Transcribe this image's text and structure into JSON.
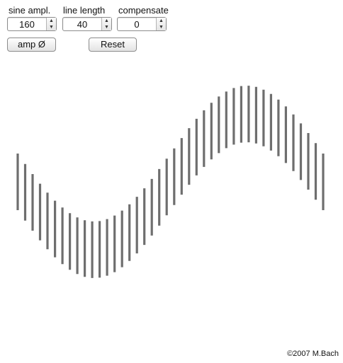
{
  "controls": {
    "sine_ampl": {
      "label": "sine ampl.",
      "value": "160"
    },
    "line_length": {
      "label": "line length",
      "value": "40"
    },
    "compensate": {
      "label": "compensate",
      "value": "0"
    }
  },
  "buttons": {
    "amp_phase": "amp Ø",
    "reset": "Reset"
  },
  "spinner_glyphs": {
    "up": "▲",
    "down": "▼"
  },
  "figure": {
    "line_count": 42,
    "cycles": 1,
    "phase": "starts at zero crossing going down, ends at zero crossing",
    "line_color": "#6e6e6e"
  },
  "footer": {
    "copyright": "©2007 M.Bach"
  }
}
